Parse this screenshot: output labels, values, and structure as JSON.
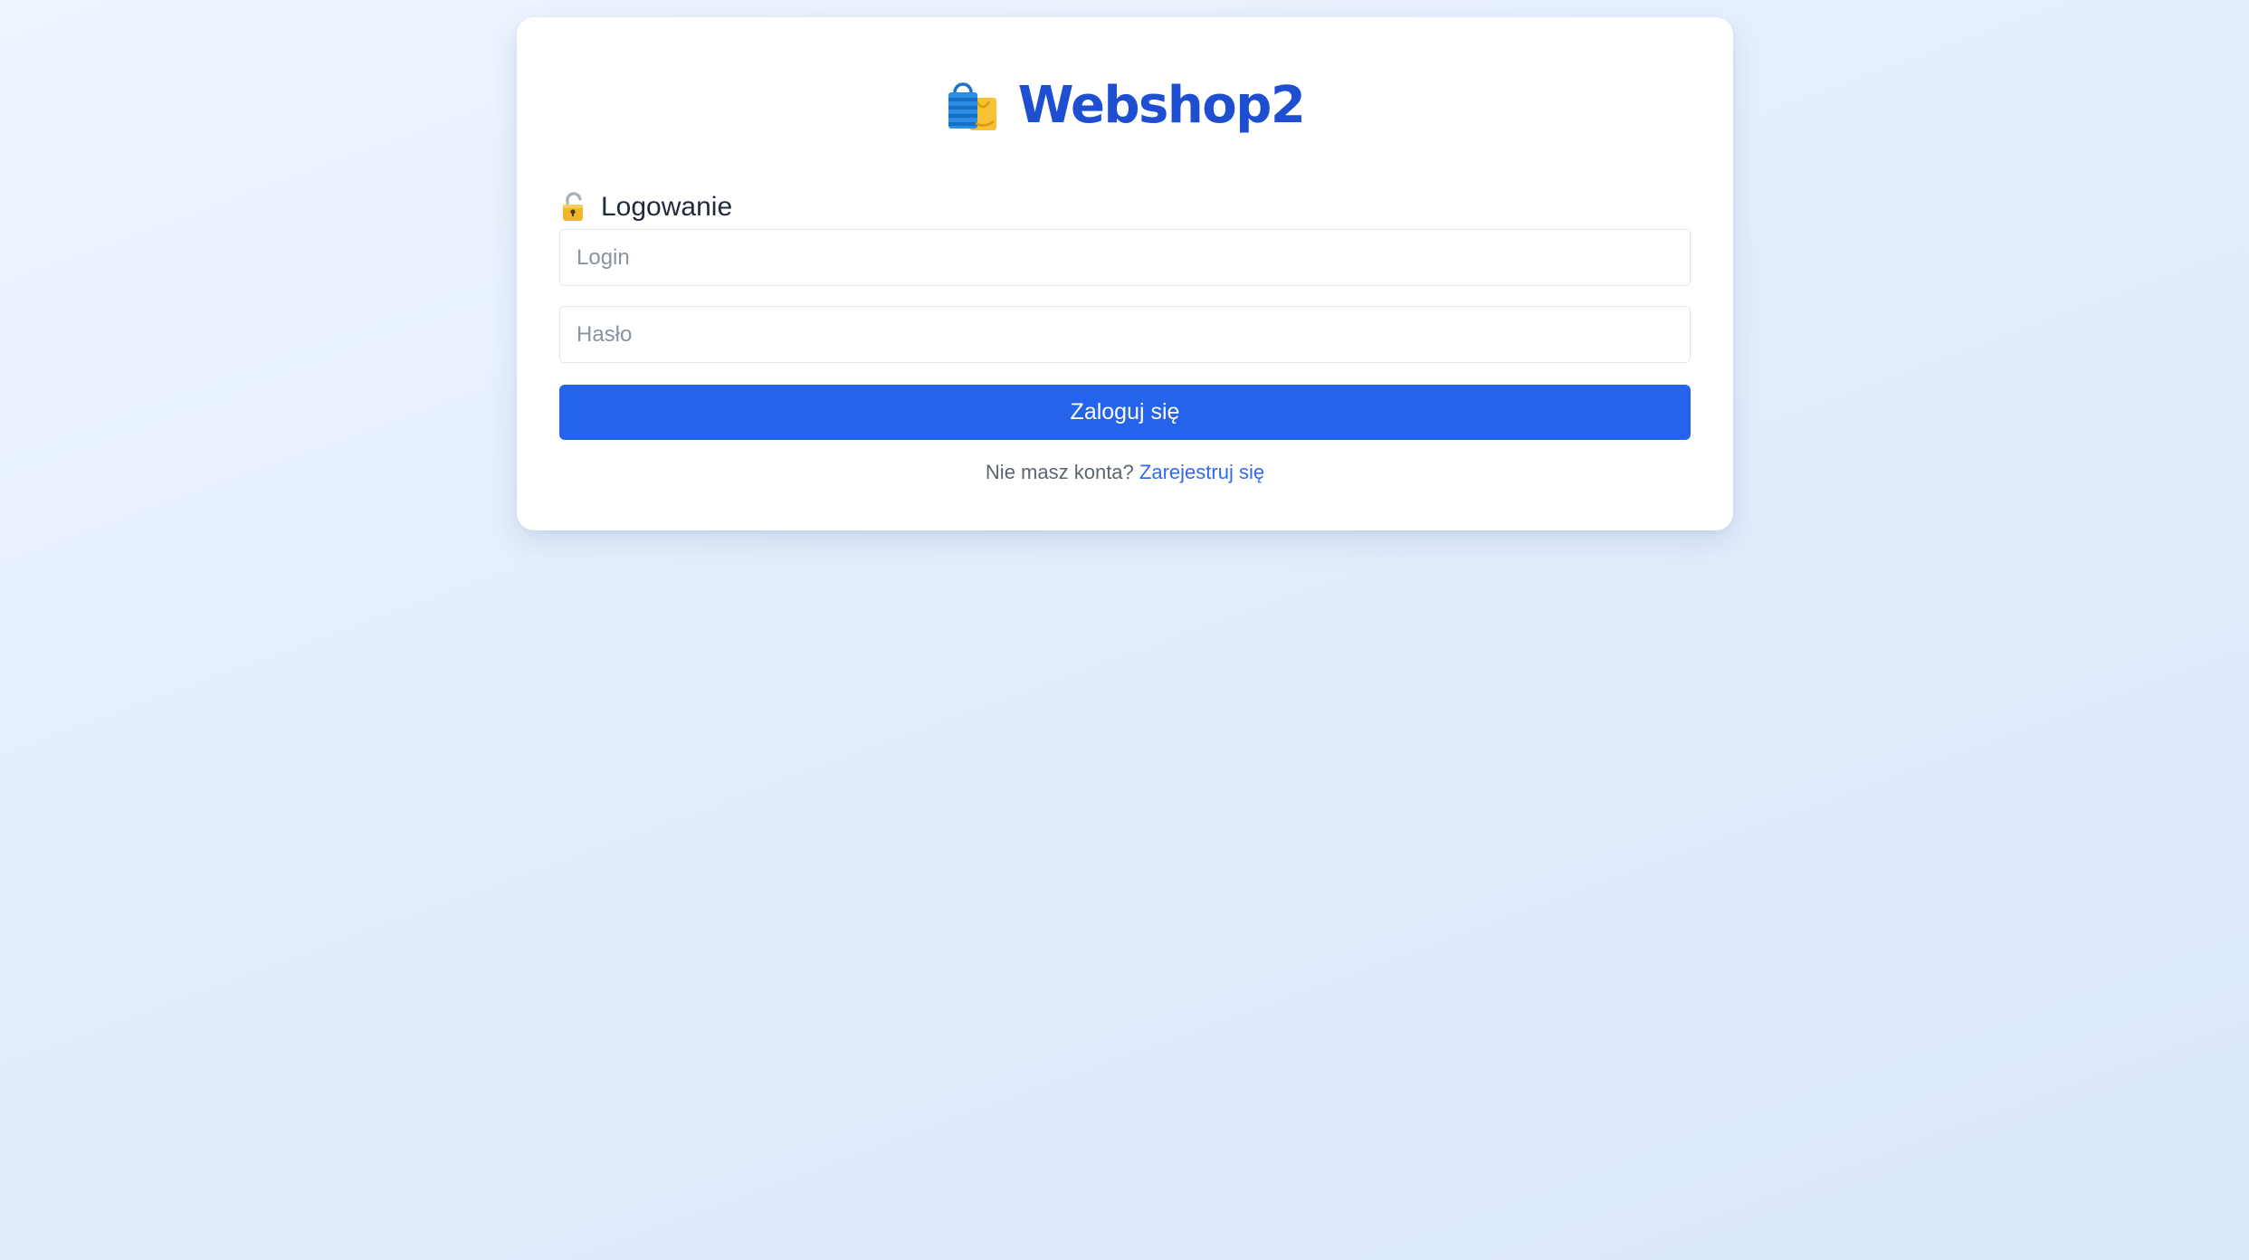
{
  "brand": {
    "title": "Webshop2",
    "icon": "shopping-bags-icon"
  },
  "login_section": {
    "title": "Logowanie",
    "icon": "lock-icon"
  },
  "form": {
    "login_placeholder": "Login",
    "login_value": "",
    "password_placeholder": "Hasło",
    "password_value": "",
    "submit_label": "Zaloguj się"
  },
  "register": {
    "prompt": "Nie masz konta?",
    "link_label": "Zarejestruj się"
  },
  "colors": {
    "brand": "#1f4fd1",
    "primary_button": "#2563eb",
    "link": "#2f6bea"
  }
}
